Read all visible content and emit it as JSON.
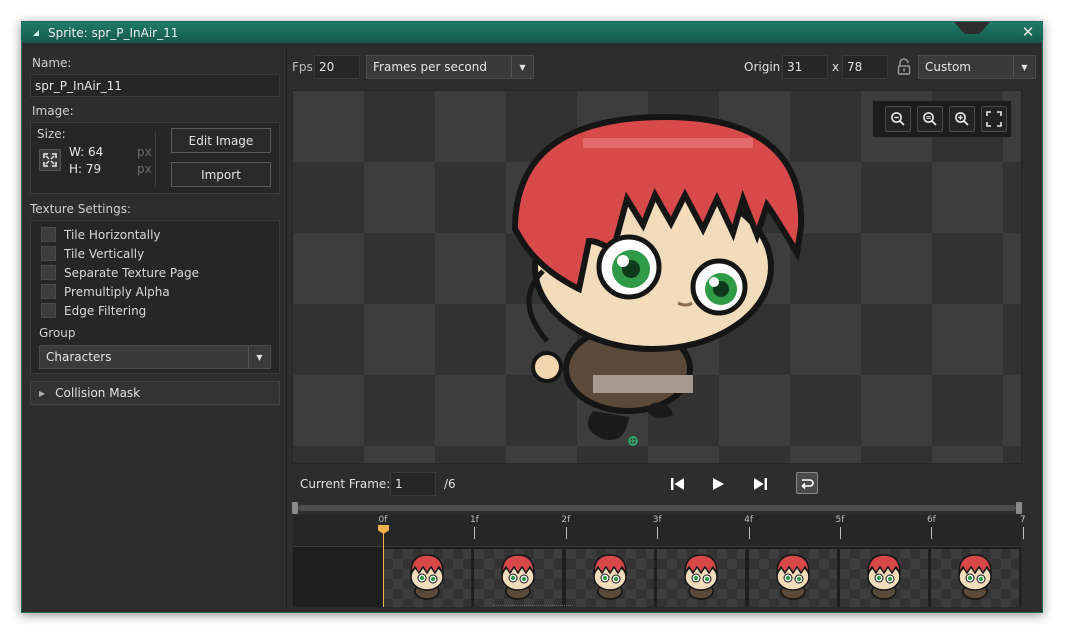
{
  "window": {
    "title": "Sprite: spr_P_InAir_11"
  },
  "left": {
    "name_label": "Name:",
    "name_value": "spr_P_InAir_11",
    "image_label": "Image:",
    "size_label": "Size:",
    "width_text": "W: 64",
    "height_text": "H: 79",
    "unit_px": "px",
    "edit_image": "Edit Image",
    "import": "Import",
    "texture_settings_label": "Texture Settings:",
    "checkboxes": [
      "Tile Horizontally",
      "Tile Vertically",
      "Separate Texture Page",
      "Premultiply Alpha",
      "Edge Filtering"
    ],
    "group_label": "Group",
    "group_value": "Characters",
    "collision_mask": "Collision Mask"
  },
  "toolbar": {
    "fps_label": "Fps",
    "fps_value": "20",
    "fps_mode": "Frames per second",
    "origin_label": "Origin",
    "origin_x": "31",
    "origin_sep": "x",
    "origin_y": "78",
    "origin_preset": "Custom"
  },
  "frames": {
    "current_label": "Current Frame:",
    "current_value": "1",
    "total": "/6",
    "ruler_labels": [
      "0f",
      "1f",
      "2f",
      "3f",
      "4f",
      "5f",
      "6f",
      "7"
    ],
    "playhead_frame": 0
  },
  "colors": {
    "accent": "#1b6e5e",
    "playhead": "#f0b34a",
    "hair": "#d84a4a",
    "eyes": "#2f9b47"
  }
}
